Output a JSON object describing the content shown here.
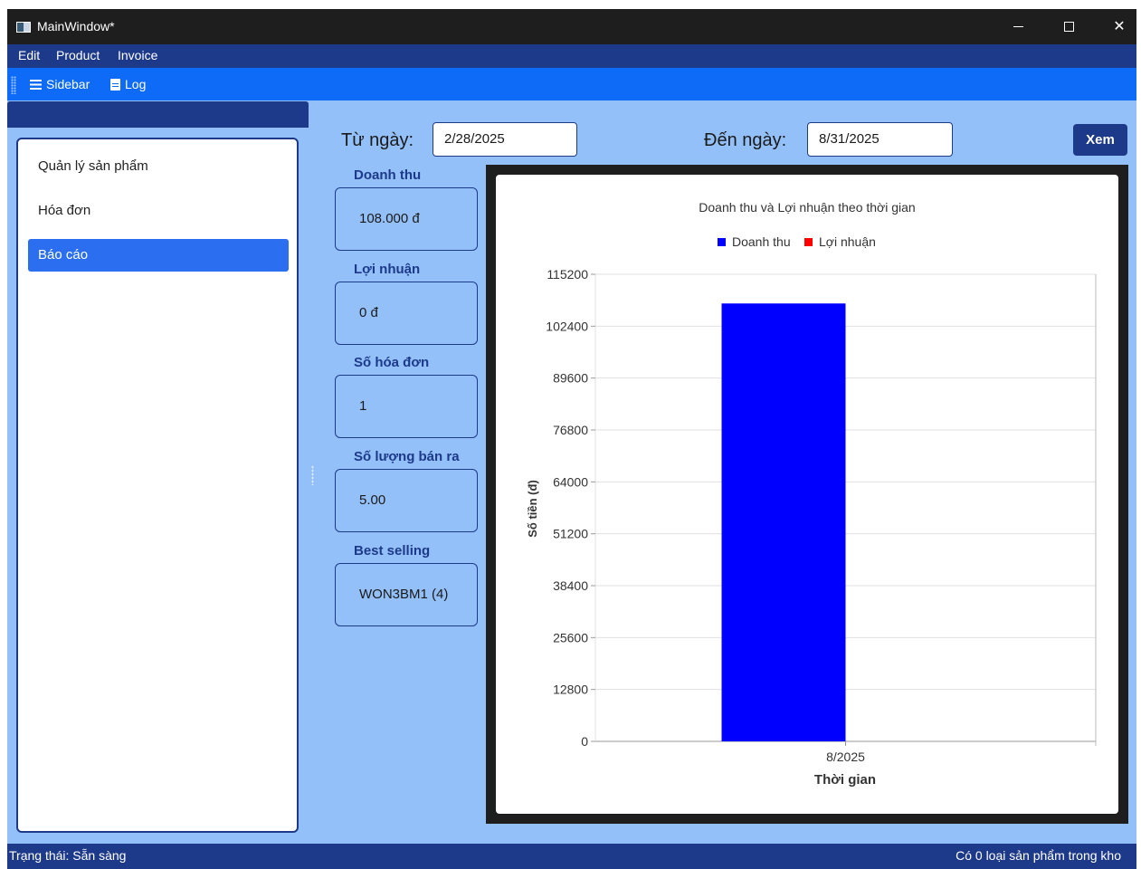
{
  "window": {
    "title": "MainWindow*"
  },
  "menu": {
    "items": [
      "Edit",
      "Product",
      "Invoice"
    ]
  },
  "toolbar": {
    "sidebar_label": "Sidebar",
    "log_label": "Log"
  },
  "sidebar": {
    "items": [
      {
        "label": "Quản lý sản phẩm",
        "active": false
      },
      {
        "label": "Hóa đơn",
        "active": false
      },
      {
        "label": "Báo cáo",
        "active": true
      }
    ]
  },
  "filter": {
    "from_label": "Từ ngày:",
    "from_value": "2/28/2025",
    "to_label": "Đến ngày:",
    "to_value": "8/31/2025",
    "view_button": "Xem"
  },
  "stats": [
    {
      "label": "Doanh thu",
      "value": "108.000 đ"
    },
    {
      "label": "Lợi nhuận",
      "value": "0 đ"
    },
    {
      "label": "Số hóa đơn",
      "value": "1"
    },
    {
      "label": "Số lượng bán ra",
      "value": "5.00"
    },
    {
      "label": "Best selling",
      "value": "WON3BM1 (4)"
    }
  ],
  "chart_data": {
    "type": "bar",
    "title": "Doanh thu và Lợi nhuận theo thời gian",
    "xlabel": "Thời gian",
    "ylabel": "Số tiền (đ)",
    "categories": [
      "8/2025"
    ],
    "series": [
      {
        "name": "Doanh thu",
        "color": "#0000ff",
        "values": [
          108000
        ]
      },
      {
        "name": "Lợi nhuận",
        "color": "#ff0000",
        "values": [
          0
        ]
      }
    ],
    "yticks": [
      0,
      12800,
      25600,
      38400,
      51200,
      64000,
      76800,
      89600,
      102400,
      115200
    ],
    "ylim": [
      0,
      115200
    ],
    "grid": true,
    "legend_position": "top-center"
  },
  "status": {
    "left": "Trạng thái: Sẵn sàng",
    "right": "Có 0 loại sản phẩm trong kho"
  }
}
